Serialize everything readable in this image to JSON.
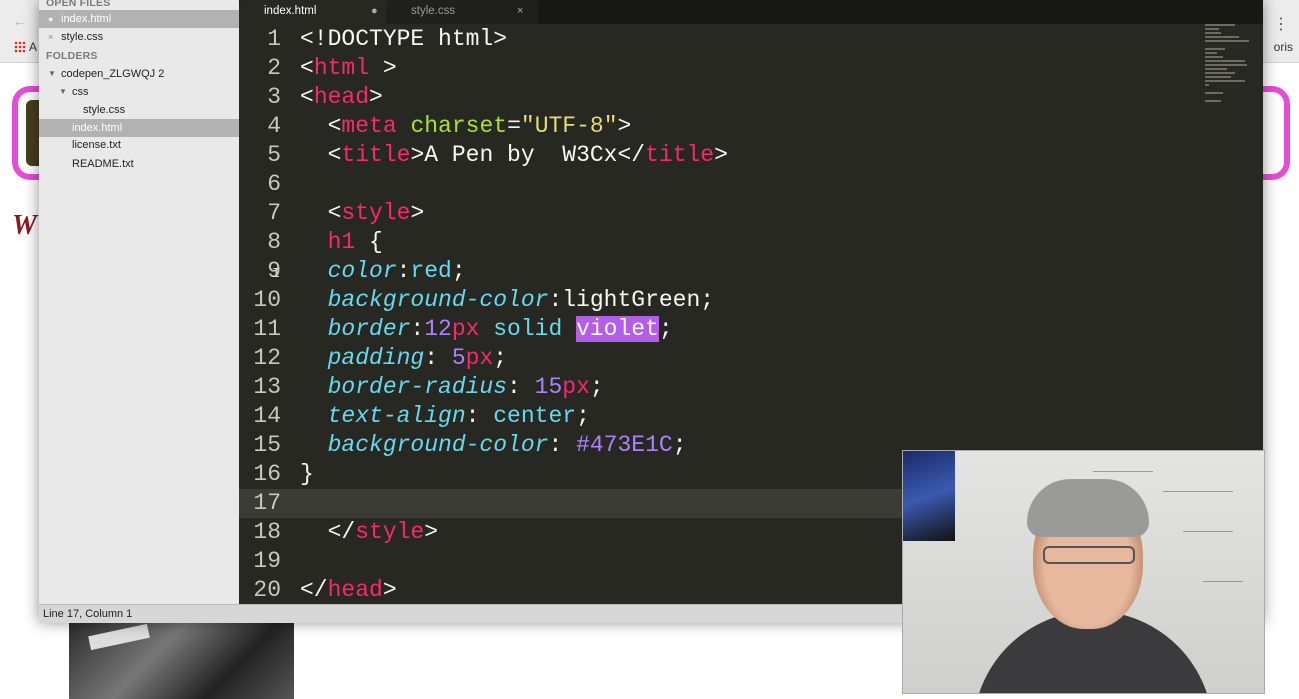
{
  "background": {
    "apps_label": "A",
    "ext_label": "oris",
    "heading_letter": "W"
  },
  "sidebar": {
    "open_files_header": "OPEN FILES",
    "open_files": [
      {
        "name": "index.html",
        "marker": "●",
        "selected": true
      },
      {
        "name": "style.css",
        "marker": "×",
        "selected": false
      }
    ],
    "folders_header": "FOLDERS",
    "tree": [
      {
        "name": "codepen_ZLGWQJ 2",
        "type": "folder",
        "depth": 0
      },
      {
        "name": "css",
        "type": "folder",
        "depth": 1
      },
      {
        "name": "style.css",
        "type": "file",
        "depth": 2
      },
      {
        "name": "index.html",
        "type": "file",
        "depth": 1,
        "selected": true
      },
      {
        "name": "license.txt",
        "type": "file",
        "depth": 1
      },
      {
        "name": "README.txt",
        "type": "file",
        "depth": 1
      }
    ]
  },
  "tabs": [
    {
      "label": "index.html",
      "active": true,
      "indicator": "●"
    },
    {
      "label": "style.css",
      "active": false,
      "indicator": "×"
    }
  ],
  "editor": {
    "current_line": 17,
    "lines": [
      [
        [
          "punc",
          "<!DOCTYPE html>"
        ]
      ],
      [
        [
          "punc",
          "<"
        ],
        [
          "tag",
          "html"
        ],
        [
          "punc",
          " >"
        ]
      ],
      [
        [
          "punc",
          "<"
        ],
        [
          "tag",
          "head"
        ],
        [
          "punc",
          ">"
        ]
      ],
      [
        [
          "punc",
          "  <"
        ],
        [
          "tag",
          "meta"
        ],
        [
          "punc",
          " "
        ],
        [
          "attr",
          "charset"
        ],
        [
          "punc",
          "="
        ],
        [
          "str",
          "\"UTF-8\""
        ],
        [
          "punc",
          ">"
        ]
      ],
      [
        [
          "punc",
          "  <"
        ],
        [
          "tag",
          "title"
        ],
        [
          "punc",
          ">A Pen by  W3Cx</"
        ],
        [
          "tag",
          "title"
        ],
        [
          "punc",
          ">"
        ]
      ],
      [],
      [
        [
          "punc",
          "  <"
        ],
        [
          "tag",
          "style"
        ],
        [
          "punc",
          ">"
        ]
      ],
      [
        [
          "tag",
          "  h1"
        ],
        [
          "punc",
          " {"
        ]
      ],
      [
        [
          "prop",
          "  color"
        ],
        [
          "punc",
          ":"
        ],
        [
          "val",
          "red"
        ],
        [
          "punc",
          ";"
        ]
      ],
      [
        [
          "prop",
          "  background-color"
        ],
        [
          "punc",
          ":lightGreen;"
        ]
      ],
      [
        [
          "prop",
          "  border"
        ],
        [
          "punc",
          ":"
        ],
        [
          "num",
          "12"
        ],
        [
          "unit",
          "px"
        ],
        [
          "val",
          " solid "
        ],
        [
          "hl",
          "violet"
        ],
        [
          "punc",
          ";"
        ]
      ],
      [
        [
          "prop",
          "  padding"
        ],
        [
          "punc",
          ": "
        ],
        [
          "num",
          "5"
        ],
        [
          "unit",
          "px"
        ],
        [
          "punc",
          ";"
        ]
      ],
      [
        [
          "prop",
          "  border-radius"
        ],
        [
          "punc",
          ": "
        ],
        [
          "num",
          "15"
        ],
        [
          "unit",
          "px"
        ],
        [
          "punc",
          ";"
        ]
      ],
      [
        [
          "prop",
          "  text-align"
        ],
        [
          "punc",
          ": "
        ],
        [
          "val",
          "center"
        ],
        [
          "punc",
          ";"
        ]
      ],
      [
        [
          "prop",
          "  background-color"
        ],
        [
          "punc",
          ": "
        ],
        [
          "num",
          "#473E1C"
        ],
        [
          "punc",
          ";"
        ]
      ],
      [
        [
          "punc",
          "}"
        ]
      ],
      [],
      [
        [
          "punc",
          "  </"
        ],
        [
          "tag",
          "style"
        ],
        [
          "punc",
          ">"
        ]
      ],
      [],
      [
        [
          "punc",
          "</"
        ],
        [
          "tag",
          "head"
        ],
        [
          "punc",
          ">"
        ]
      ]
    ]
  },
  "status": {
    "text": "Line 17, Column 1"
  },
  "colors": {
    "editor_bg": "#272822",
    "tag": "#f92672",
    "attr": "#a6e22e",
    "string": "#e6db74",
    "property": "#66d9ef",
    "number": "#ae81ff",
    "selection_highlight": "#b25ee6",
    "page_border_pink": "#e54dd6"
  },
  "icons": {
    "apps": "apps-grid-icon",
    "back": "back-arrow-icon",
    "menu": "kebab-menu-icon",
    "ibeam": "text-cursor-icon"
  }
}
